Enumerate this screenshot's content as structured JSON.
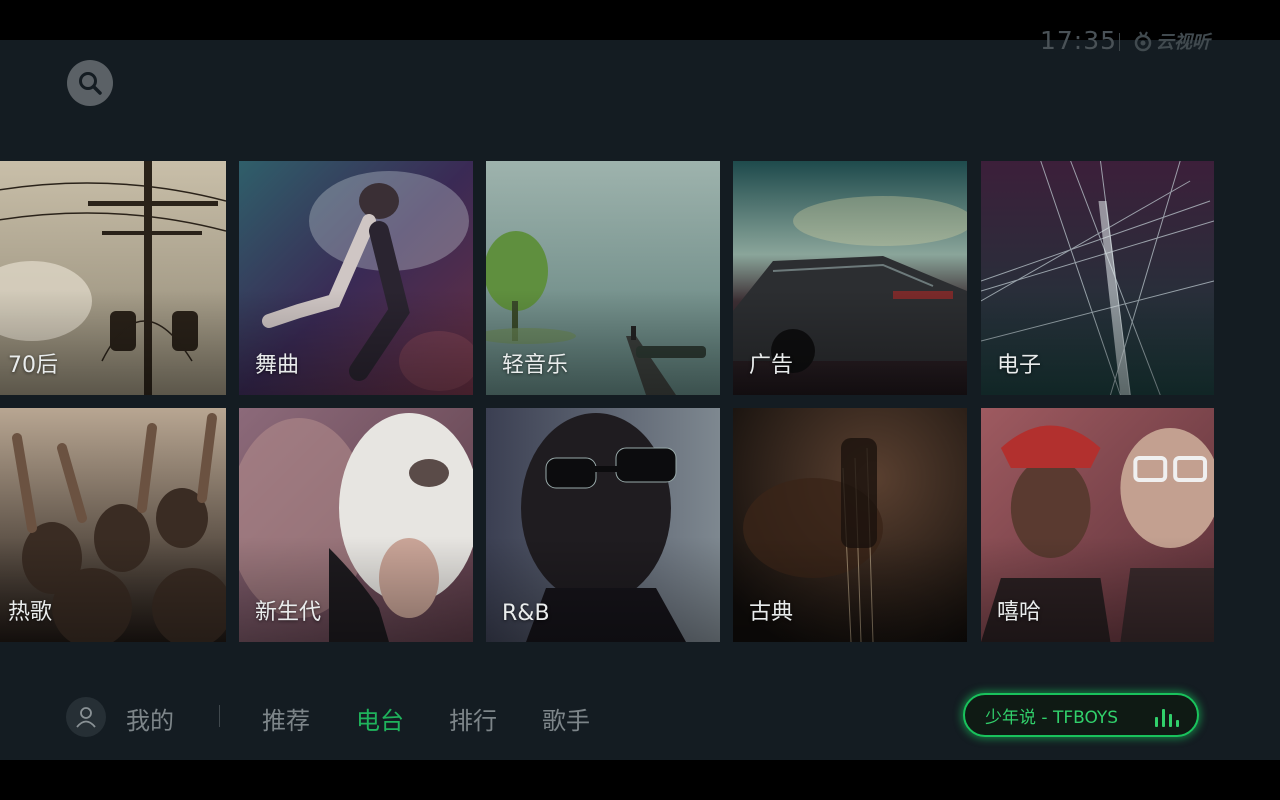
{
  "header": {
    "time": "17:35",
    "brand": "云视听"
  },
  "tiles": [
    {
      "label": "70后"
    },
    {
      "label": "舞曲"
    },
    {
      "label": "轻音乐"
    },
    {
      "label": "广告"
    },
    {
      "label": "电子"
    },
    {
      "label": "热歌"
    },
    {
      "label": "新生代"
    },
    {
      "label": "R&B"
    },
    {
      "label": "古典"
    },
    {
      "label": "嘻哈"
    }
  ],
  "nav": {
    "mine": "我的",
    "items": [
      {
        "label": "推荐"
      },
      {
        "label": "电台"
      },
      {
        "label": "排行"
      },
      {
        "label": "歌手"
      }
    ],
    "active": "电台"
  },
  "now_playing": {
    "text": "少年说 - TFBOYS"
  },
  "colors": {
    "accent": "#1fb35c",
    "background": "#141c22"
  }
}
